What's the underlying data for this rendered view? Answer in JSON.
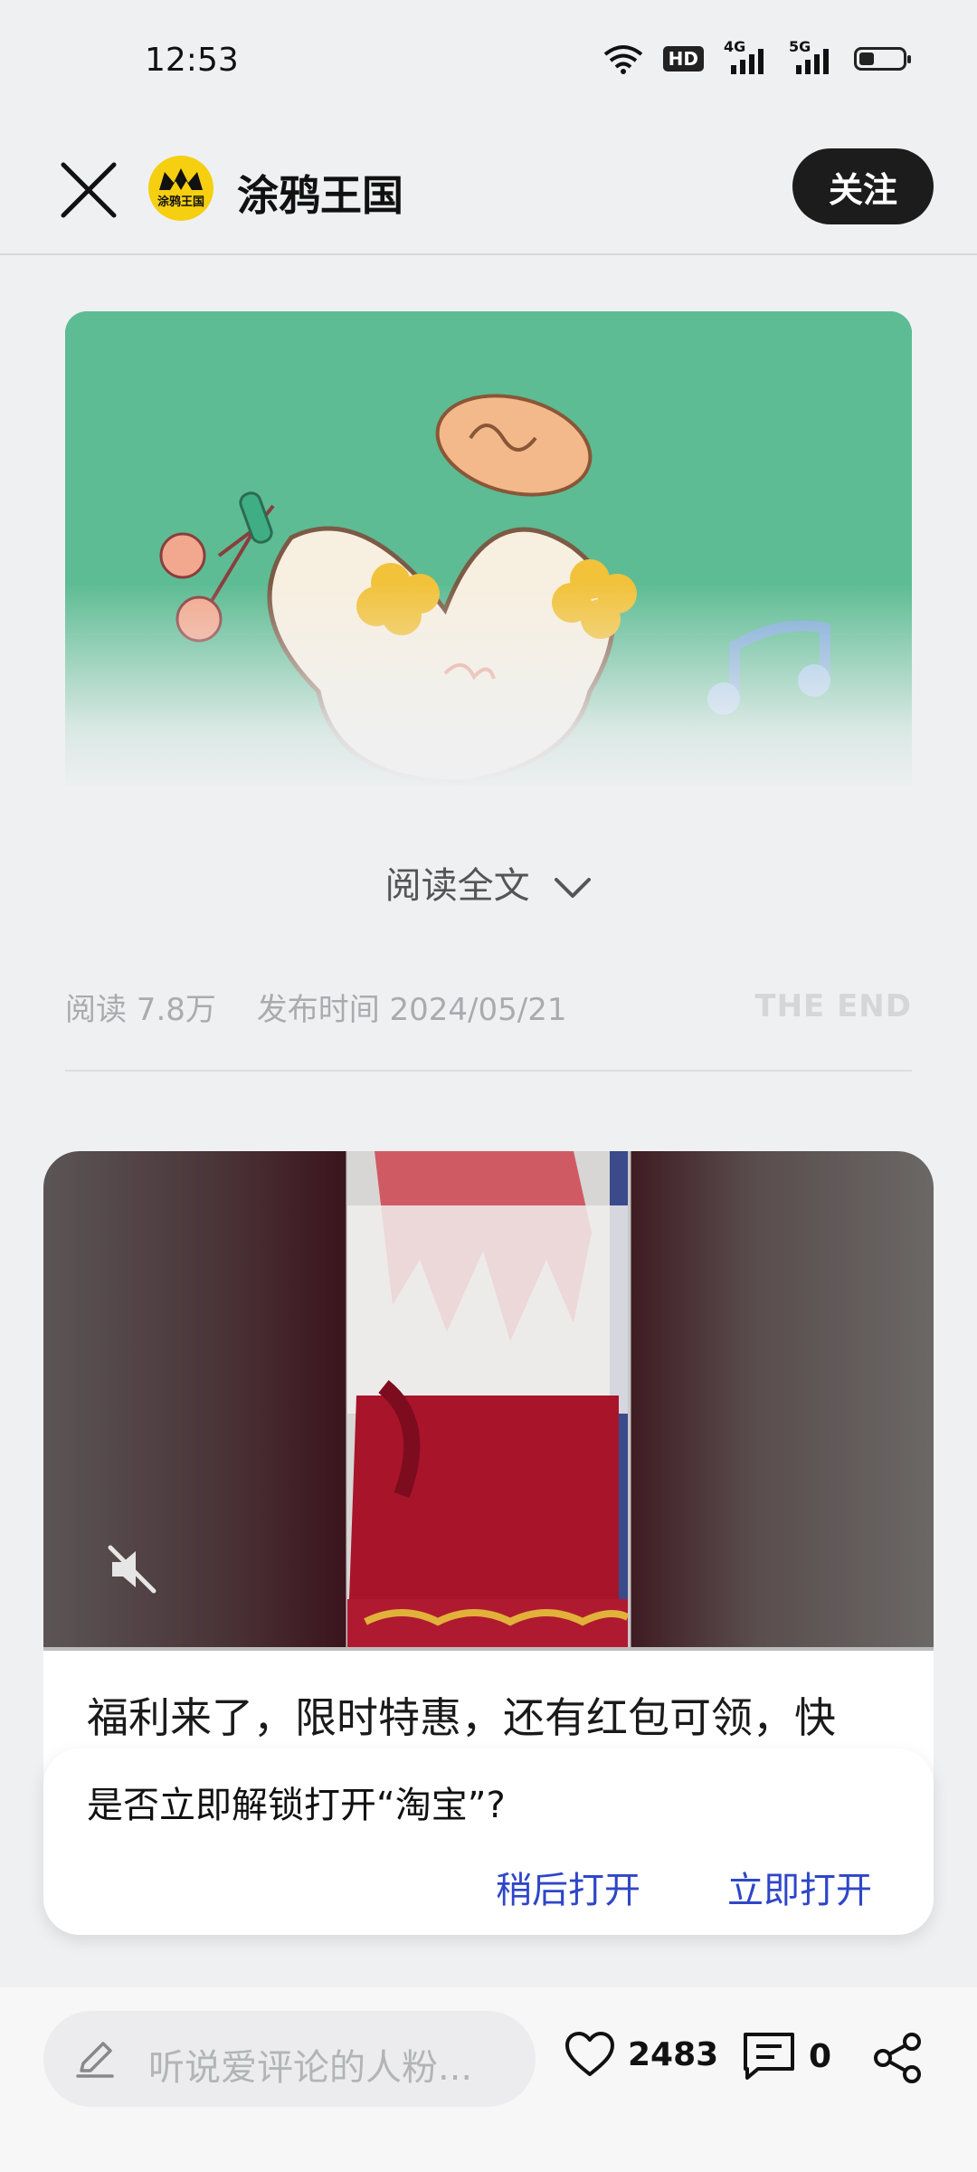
{
  "status_bar": {
    "time": "12:53",
    "wifi_icon": "wifi-icon",
    "hd_badge": "HD",
    "net1": "4G",
    "net2": "5G",
    "battery_level": 0.35
  },
  "header": {
    "close_icon": "close-icon",
    "avatar_text": "涂鸦王国",
    "account_name": "涂鸦王国",
    "follow_label": "关注"
  },
  "article": {
    "read_more_label": "阅读全文",
    "read_count": "阅读 7.8万",
    "publish_time": "发布时间 2024/05/21",
    "end_label": "THE END"
  },
  "ad": {
    "title": "福利来了，限时特惠，还有红包可领，快",
    "muted": true
  },
  "dialog": {
    "message": "是否立即解锁打开“淘宝”?",
    "later_label": "稍后打开",
    "open_label": "立即打开"
  },
  "bottom_bar": {
    "comment_placeholder": "听说爱评论的人粉...",
    "like_count": "2483",
    "comment_count": "0"
  },
  "colors": {
    "background": "#eff0f2",
    "follow_button": "#1c1c1c",
    "dialog_action": "#2f46c8",
    "cover_green": "#5dbc93"
  }
}
